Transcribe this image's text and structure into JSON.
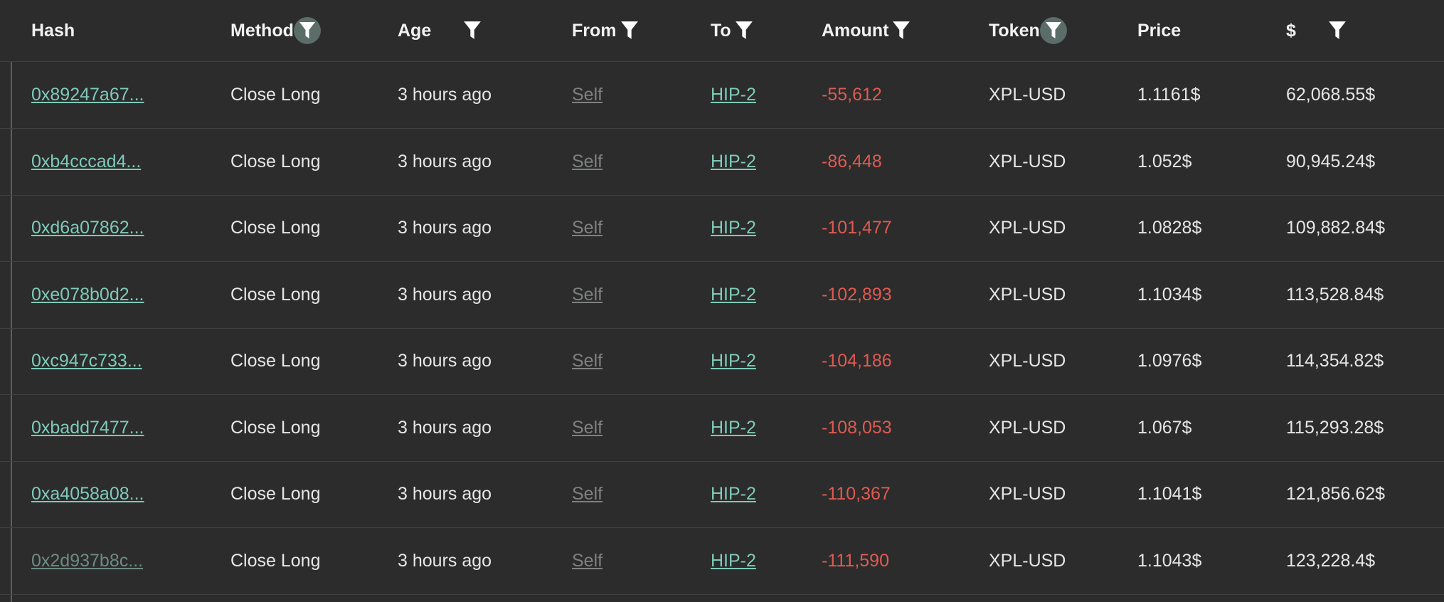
{
  "columns": [
    {
      "label": "Hash",
      "filter": "none"
    },
    {
      "label": "Method",
      "filter": "active"
    },
    {
      "label": "Age",
      "filter": "plain"
    },
    {
      "label": "From",
      "filter": "plain"
    },
    {
      "label": "To",
      "filter": "plain"
    },
    {
      "label": "Amount",
      "filter": "plain"
    },
    {
      "label": "Token",
      "filter": "active"
    },
    {
      "label": "Price",
      "filter": "none"
    },
    {
      "label": "$",
      "filter": "plain"
    }
  ],
  "colors": {
    "background": "#2b2c2b",
    "link": "#7fcab8",
    "negative": "#e05a52",
    "muted_link": "#7f8180",
    "active_filter_bg": "#5b6d68"
  },
  "icons": {
    "filter": "filter-funnel-icon"
  },
  "rows": [
    {
      "hash": "0x89247a67...",
      "method": "Close Long",
      "age": "3 hours ago",
      "from": "Self",
      "to": "HIP-2",
      "amount": "-55,612",
      "token": "XPL-USD",
      "price": "1.1161$",
      "usd": "62,068.55$"
    },
    {
      "hash": "0xb4cccad4...",
      "method": "Close Long",
      "age": "3 hours ago",
      "from": "Self",
      "to": "HIP-2",
      "amount": "-86,448",
      "token": "XPL-USD",
      "price": "1.052$",
      "usd": "90,945.24$"
    },
    {
      "hash": "0xd6a07862...",
      "method": "Close Long",
      "age": "3 hours ago",
      "from": "Self",
      "to": "HIP-2",
      "amount": "-101,477",
      "token": "XPL-USD",
      "price": "1.0828$",
      "usd": "109,882.84$"
    },
    {
      "hash": "0xe078b0d2...",
      "method": "Close Long",
      "age": "3 hours ago",
      "from": "Self",
      "to": "HIP-2",
      "amount": "-102,893",
      "token": "XPL-USD",
      "price": "1.1034$",
      "usd": "113,528.84$"
    },
    {
      "hash": "0xc947c733...",
      "method": "Close Long",
      "age": "3 hours ago",
      "from": "Self",
      "to": "HIP-2",
      "amount": "-104,186",
      "token": "XPL-USD",
      "price": "1.0976$",
      "usd": "114,354.82$"
    },
    {
      "hash": "0xbadd7477...",
      "method": "Close Long",
      "age": "3 hours ago",
      "from": "Self",
      "to": "HIP-2",
      "amount": "-108,053",
      "token": "XPL-USD",
      "price": "1.067$",
      "usd": "115,293.28$"
    },
    {
      "hash": "0xa4058a08...",
      "method": "Close Long",
      "age": "3 hours ago",
      "from": "Self",
      "to": "HIP-2",
      "amount": "-110,367",
      "token": "XPL-USD",
      "price": "1.1041$",
      "usd": "121,856.62$"
    },
    {
      "hash": "0x2d937b8c...",
      "method": "Close Long",
      "age": "3 hours ago",
      "from": "Self",
      "to": "HIP-2",
      "amount": "-111,590",
      "token": "XPL-USD",
      "price": "1.1043$",
      "usd": "123,228.4$"
    }
  ]
}
